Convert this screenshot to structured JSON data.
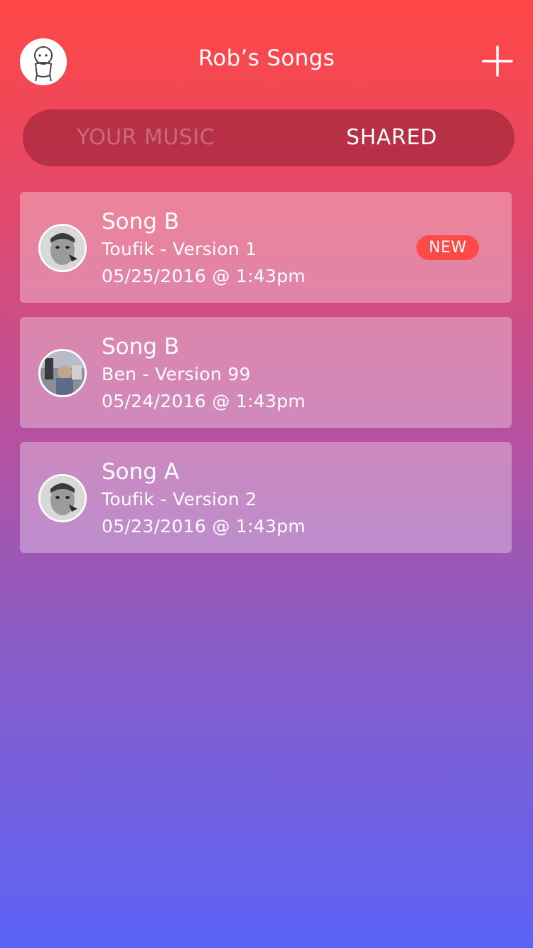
{
  "header": {
    "title": "Rob’s Songs",
    "profile_icon": "user-avatar",
    "add_icon": "plus-icon"
  },
  "tabs": {
    "your_music": "YOUR MUSIC",
    "shared": "SHARED",
    "active": "SHARED"
  },
  "songs": [
    {
      "name": "Song B",
      "subtitle": "Toufik - Version 1",
      "date": "05/25/2016 @ 1:43pm",
      "badge": "NEW"
    },
    {
      "name": "Song B",
      "subtitle": "Ben - Version 99",
      "date": "05/24/2016 @ 1:43pm"
    },
    {
      "name": "Song A",
      "subtitle": "Toufik - Version 2",
      "date": "05/23/2016 @ 1:43pm"
    }
  ],
  "colors": {
    "badge": "#ff4a47",
    "gradient_top": "#ff4744",
    "gradient_bottom": "#5b63f7"
  }
}
